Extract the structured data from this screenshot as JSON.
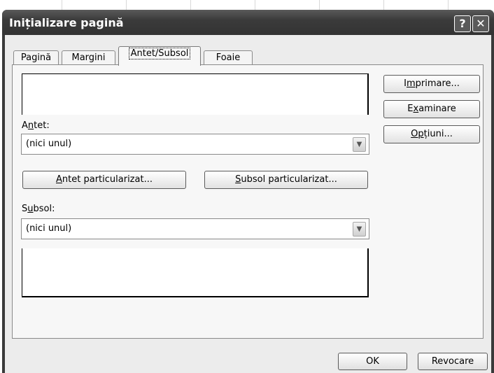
{
  "dialog": {
    "title": "Inițializare pagină",
    "help_button": "?",
    "close_button": "✕"
  },
  "tabs": [
    {
      "label": "Pagină"
    },
    {
      "label": "Margini"
    },
    {
      "label": "Antet/Subsol",
      "active": true
    },
    {
      "label": "Foaie"
    }
  ],
  "header": {
    "label_pre": "A",
    "label_key": "n",
    "label_post": "tet:",
    "value": "(nici unul)",
    "custom_pre": "",
    "custom_key": "A",
    "custom_post": "ntet particularizat..."
  },
  "footer": {
    "label_pre": "S",
    "label_key": "u",
    "label_post": "bsol:",
    "value": "(nici unul)",
    "custom_pre": "",
    "custom_key": "S",
    "custom_post": "ubsol particularizat..."
  },
  "side_buttons": [
    {
      "pre": "I",
      "key": "m",
      "post": "primare..."
    },
    {
      "pre": "E",
      "key": "x",
      "post": "aminare"
    },
    {
      "pre": "",
      "key": "Op",
      "post": "țiuni..."
    }
  ],
  "footer_buttons": {
    "ok": "OK",
    "cancel": "Revocare"
  },
  "icons": {
    "dropdown": "chevron-down-icon"
  }
}
